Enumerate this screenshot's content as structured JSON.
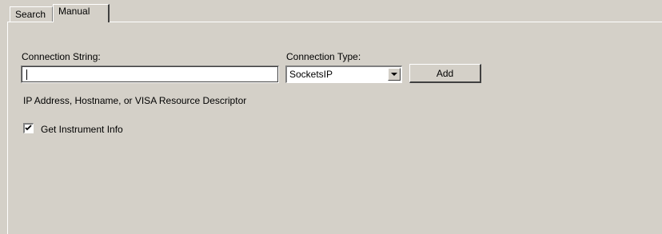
{
  "tabs": [
    {
      "label": "Search",
      "active": false
    },
    {
      "label": "Manual",
      "active": true
    }
  ],
  "form": {
    "connection_string_label": "Connection String:",
    "connection_string_value": "",
    "connection_type_label": "Connection Type:",
    "connection_type_selected": "SocketsIP",
    "add_button_label": "Add",
    "hint": "IP Address, Hostname, or VISA Resource Descriptor",
    "get_instrument_info_label": "Get Instrument Info",
    "get_instrument_info_checked": true
  },
  "icons": {
    "dropdown": "chevron-down-icon",
    "checkmark": "checkmark-icon"
  },
  "colors": {
    "face": "#d4d0c8",
    "highlight": "#ffffff",
    "shadow": "#808080",
    "dark_shadow": "#404040"
  }
}
